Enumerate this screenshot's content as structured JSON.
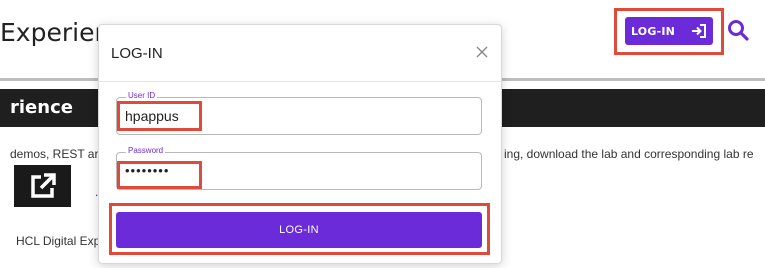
{
  "site": {
    "title": "Experience",
    "hero_title": "rience",
    "body_left": "demos, REST ar",
    "body_right": "ing, download the lab and corresponding lab re",
    "link_tail": ".",
    "footer": "HCL Digital Exp"
  },
  "header": {
    "login_button_label": "LOG-IN",
    "login_icon": "sign-in-icon",
    "search_icon": "search-icon"
  },
  "modal": {
    "title": "LOG-IN",
    "close_icon": "close-icon",
    "user_id": {
      "label": "User ID",
      "value": "hpappus"
    },
    "password": {
      "label": "Password",
      "value": "••••••••"
    },
    "submit_label": "LOG-IN"
  },
  "colors": {
    "accent": "#6c2bd9",
    "highlight": "#e04a3a",
    "hero_background": "#1f1f1f"
  }
}
